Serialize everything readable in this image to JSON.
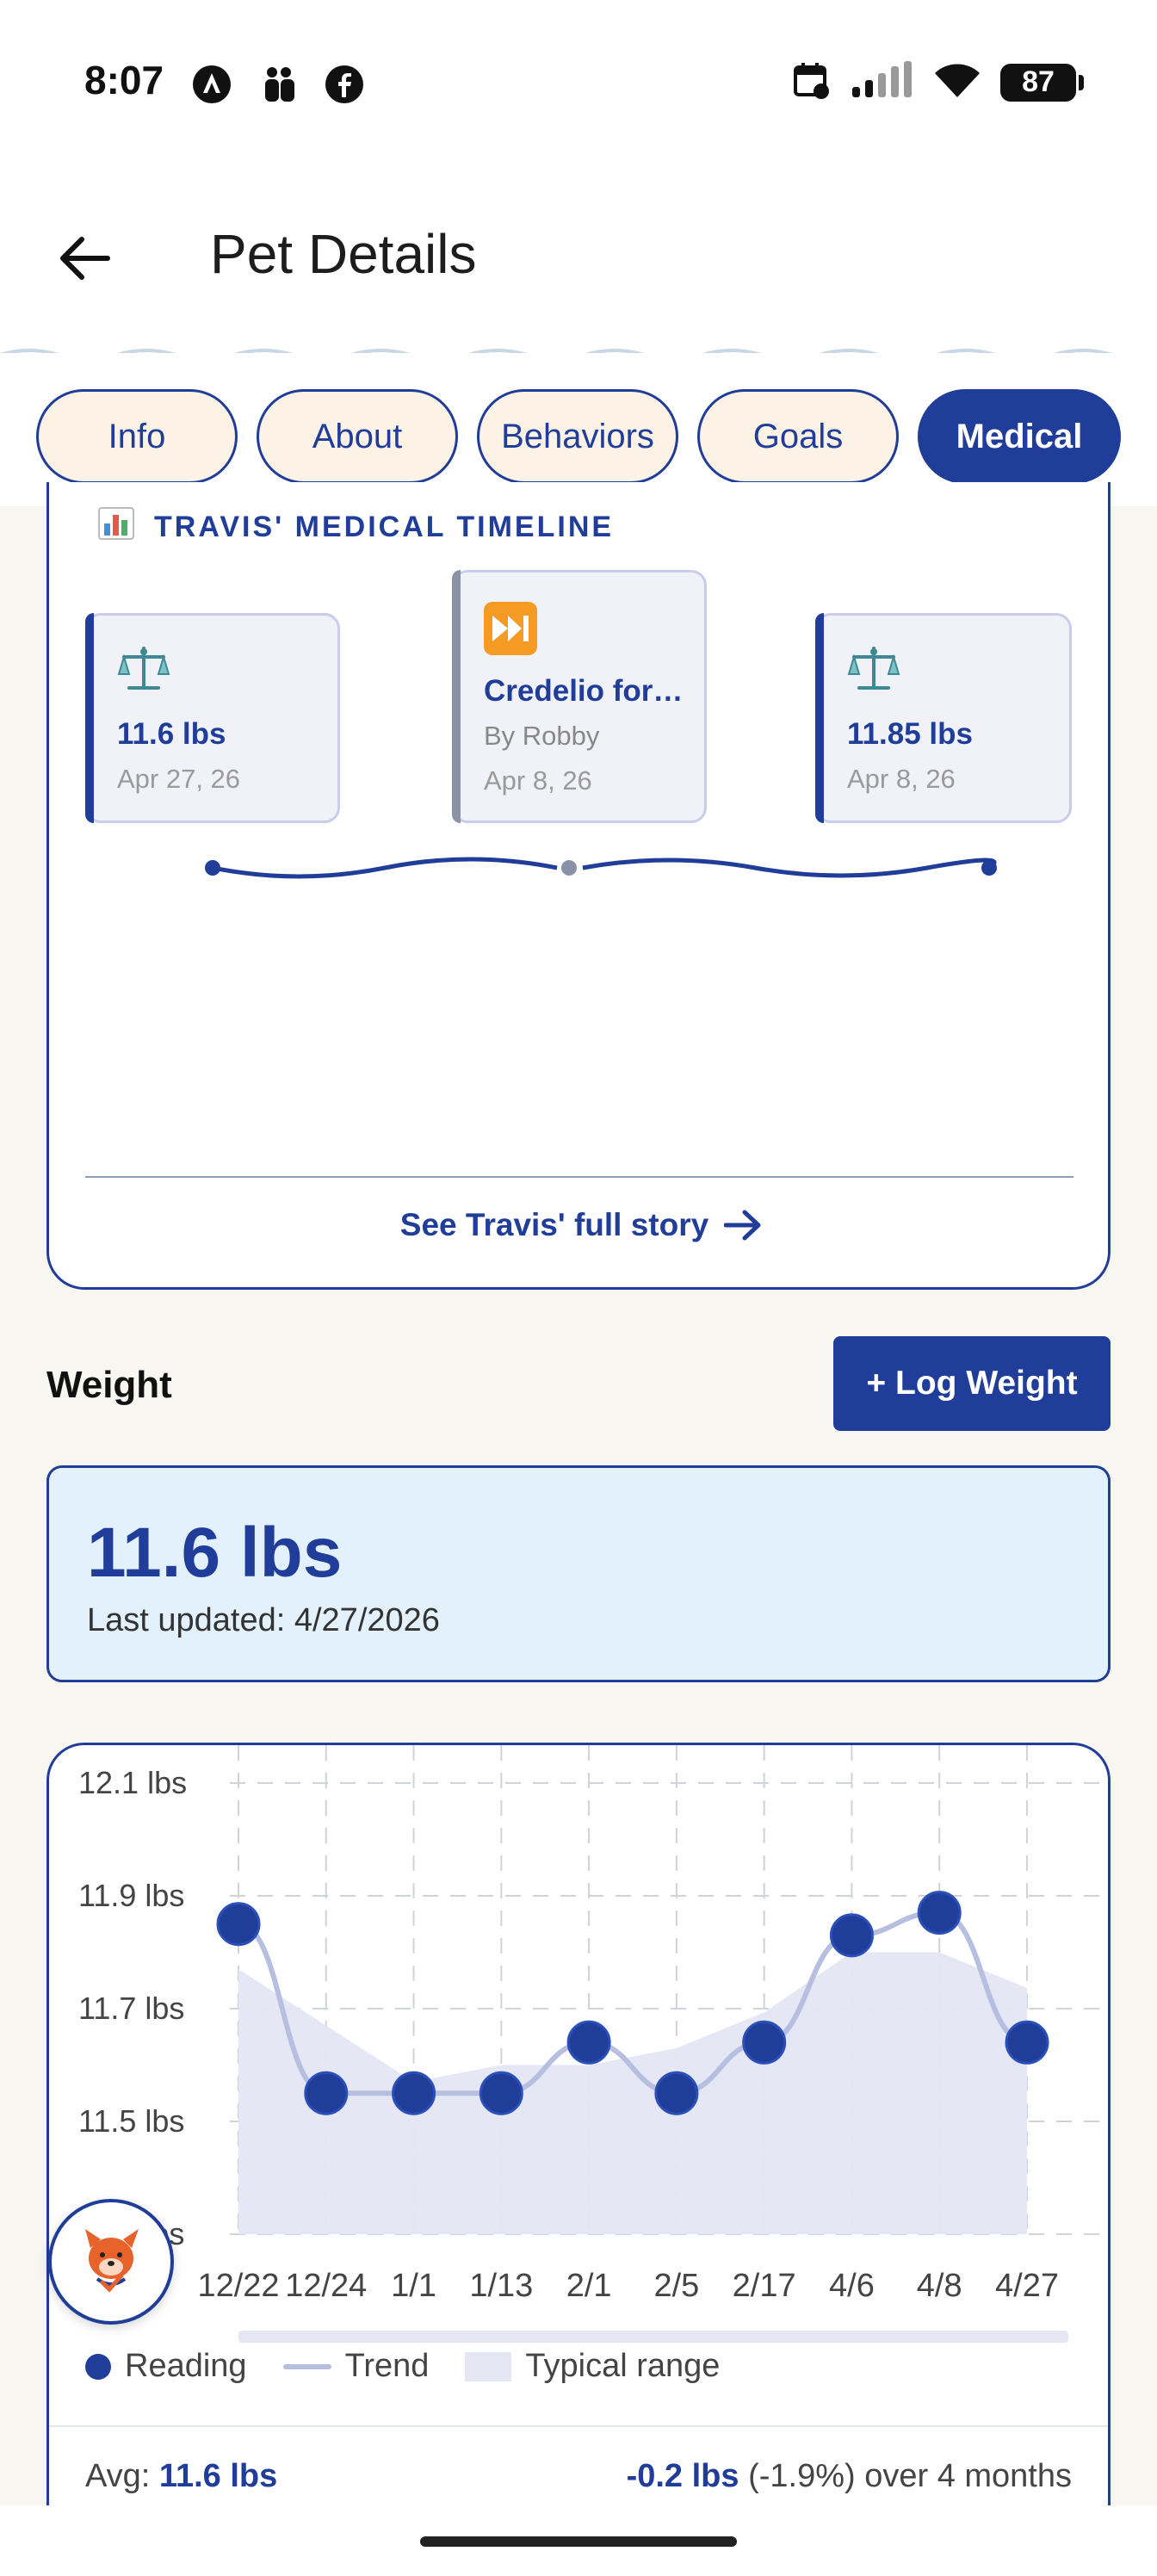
{
  "status_bar": {
    "time": "8:07",
    "battery": "87"
  },
  "header": {
    "title": "Pet Details"
  },
  "tabs": [
    {
      "label": "Info",
      "active": false
    },
    {
      "label": "About",
      "active": false
    },
    {
      "label": "Behaviors",
      "active": false
    },
    {
      "label": "Goals",
      "active": false
    },
    {
      "label": "Medical",
      "active": true
    }
  ],
  "timeline": {
    "heading": "TRAVIS' MEDICAL TIMELINE",
    "events": [
      {
        "icon": "scale-icon",
        "title": "11.6 lbs",
        "subtitle": "",
        "date": "Apr 27, 26"
      },
      {
        "icon": "fast-forward-icon",
        "title": "Credelio for…",
        "subtitle": "By Robby",
        "date": "Apr 8, 26"
      },
      {
        "icon": "scale-icon",
        "title": "11.85 lbs",
        "subtitle": "",
        "date": "Apr 8, 26"
      }
    ],
    "see_story": "See Travis' full story"
  },
  "weight": {
    "section_label": "Weight",
    "log_button": "+ Log Weight",
    "current": "11.6 lbs",
    "last_updated": "Last updated: 4/27/2026"
  },
  "chart_data": {
    "type": "line",
    "categories": [
      "12/22",
      "12/24",
      "1/1",
      "1/13",
      "2/1",
      "2/5",
      "2/17",
      "4/6",
      "4/8",
      "4/27"
    ],
    "series": [
      {
        "name": "Reading",
        "values": [
          11.85,
          11.55,
          11.55,
          11.55,
          11.64,
          11.55,
          11.64,
          11.83,
          11.87,
          11.64
        ]
      }
    ],
    "y_ticks": [
      "12.1 lbs",
      "11.9 lbs",
      "11.7 lbs",
      "11.5 lbs",
      "11.3 lbs"
    ],
    "ylim": [
      11.3,
      12.1
    ],
    "grid": true,
    "legend": {
      "reading": "Reading",
      "trend": "Trend",
      "range": "Typical range"
    },
    "colors": {
      "reading": "#1f3d99",
      "trend": "#b6bfe0",
      "range": "#e4e6f4"
    }
  },
  "summary": {
    "avg_label": "Avg:",
    "avg_value": "11.6 lbs",
    "change_value": "-0.2 lbs",
    "change_rest": "(-1.9%) over 4 months"
  }
}
